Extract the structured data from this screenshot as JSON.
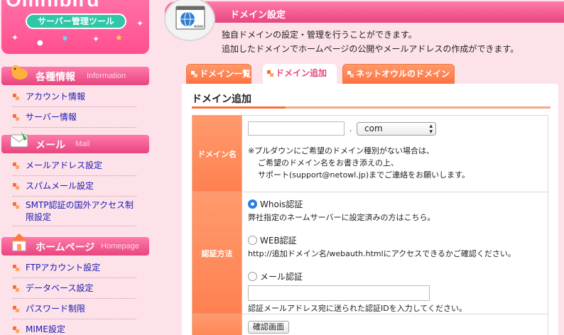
{
  "sidebar": {
    "logo_text": "Omnibird",
    "logo_subtitle": "サーバー管理ツール",
    "sections": [
      {
        "title": "各種情報",
        "title_en": "Information",
        "icon": "bird-icon",
        "items": [
          {
            "label": "アカウント情報"
          },
          {
            "label": "サーバー情報"
          }
        ]
      },
      {
        "title": "メール",
        "title_en": "Mail",
        "icon": "envelope-icon",
        "items": [
          {
            "label": "メールアドレス設定"
          },
          {
            "label": "スパムメール設定"
          },
          {
            "label": "SMTP認証の国外アクセス制限設定"
          }
        ]
      },
      {
        "title": "ホームページ",
        "title_en": "Homepage",
        "icon": "house-icon",
        "items": [
          {
            "label": "FTPアカウント設定"
          },
          {
            "label": "データベース設定"
          },
          {
            "label": "パスワード制限"
          },
          {
            "label": "MIME設定"
          }
        ]
      }
    ]
  },
  "header": {
    "title": "ドメイン設定",
    "icon": "globe-www-icon",
    "description_1": "独自ドメインの設定・管理を行うことができます。",
    "description_2": "追加したドメインでホームページの公開やメールアドレスの作成ができます。"
  },
  "tabs": [
    {
      "label": "ドメイン一覧",
      "active": false
    },
    {
      "label": "ドメイン追加",
      "active": true
    },
    {
      "label": "ネットオウルのドメイン",
      "active": false
    }
  ],
  "panel": {
    "title": "ドメイン追加",
    "domain_row": {
      "label": "ドメイン名",
      "input_value": "",
      "separator": ".",
      "tld_selected": "com",
      "note_1": "※プルダウンにご希望のドメイン種別がない場合は、",
      "note_2": "ご希望のドメイン名をお書き添えの上、",
      "note_3": "サポート(support@netowl.jp)までご連絡をお願いします。"
    },
    "auth_row": {
      "label": "認証方法",
      "options": [
        {
          "label": "Whois認証",
          "checked": true,
          "desc": "弊社指定のネームサーバーに設定済みの方はこちら。"
        },
        {
          "label": "WEB認証",
          "checked": false,
          "desc": "http://追加ドメイン名/webauth.htmlにアクセスできるかご確認ください。"
        },
        {
          "label": "メール認証",
          "checked": false,
          "desc": "認証メールアドレス宛に送られた認証IDを入力してください。"
        }
      ],
      "mail_input_value": ""
    },
    "confirm_button": "確認画面"
  },
  "colors": {
    "pink_header": "#e8457f",
    "pink_bg": "#fde2ea",
    "orange_tab": "#ff7340",
    "link_blue": "#1a1ab0",
    "teal_pill": "#2ec7a8"
  }
}
